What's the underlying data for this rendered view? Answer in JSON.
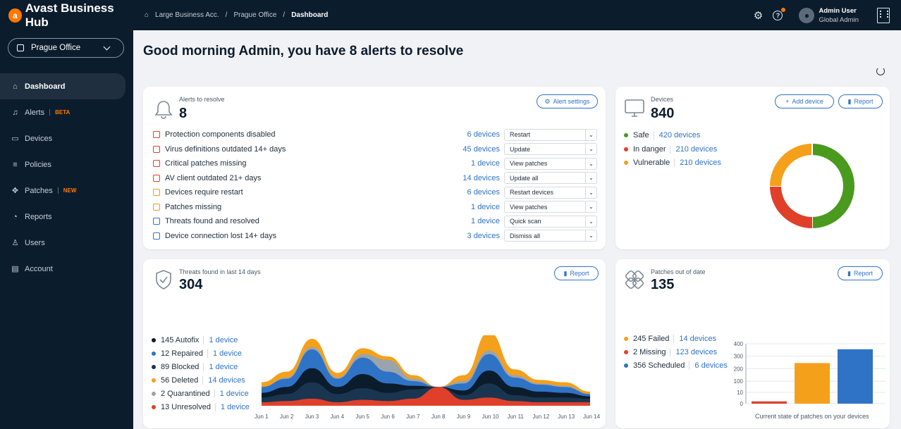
{
  "brand": {
    "name": "Avast Business Hub"
  },
  "breadcrumb": [
    "Large Business Acc.",
    "Prague Office",
    "Dashboard"
  ],
  "user": {
    "name": "Admin User",
    "role": "Global Admin"
  },
  "location": "Prague Office",
  "nav": [
    {
      "label": "Dashboard",
      "icon": "home-icon",
      "active": true
    },
    {
      "label": "Alerts",
      "icon": "bell-icon",
      "badge": "BETA"
    },
    {
      "label": "Devices",
      "icon": "monitor-icon"
    },
    {
      "label": "Policies",
      "icon": "policies-icon"
    },
    {
      "label": "Patches",
      "icon": "patches-icon",
      "badge": "NEW"
    },
    {
      "label": "Reports",
      "icon": "reports-icon"
    },
    {
      "label": "Users",
      "icon": "user-icon"
    },
    {
      "label": "Account",
      "icon": "account-icon"
    }
  ],
  "greeting": "Good morning Admin, you have 8 alerts to resolve",
  "alerts": {
    "title": "Alerts to resolve",
    "count": "8",
    "settings_label": "Alert settings",
    "rows": [
      {
        "label": "Protection components disabled",
        "count": "6 devices",
        "action": "Restart",
        "color": "#e0402a"
      },
      {
        "label": "Virus definitions outdated 14+ days",
        "count": "45 devices",
        "action": "Update",
        "color": "#e0402a"
      },
      {
        "label": "Critical patches missing",
        "count": "1 device",
        "action": "View patches",
        "color": "#e0402a"
      },
      {
        "label": "AV client outdated 21+ days",
        "count": "14 devices",
        "action": "Update all",
        "color": "#e0402a"
      },
      {
        "label": "Devices require restart",
        "count": "6 devices",
        "action": "Restart devices",
        "color": "#f29b14"
      },
      {
        "label": "Patches missing",
        "count": "1 device",
        "action": "View patches",
        "color": "#f29b14"
      },
      {
        "label": "Threats found and resolved",
        "count": "1 device",
        "action": "Quick scan",
        "color": "#2f73c6"
      },
      {
        "label": "Device connection lost 14+ days",
        "count": "3 devices",
        "action": "Dismiss all",
        "color": "#2f73c6"
      }
    ]
  },
  "devices": {
    "title": "Devices",
    "count": "840",
    "add_label": "Add device",
    "report_label": "Report",
    "legend": [
      {
        "label": "Safe",
        "count": "420 devices",
        "value": 420,
        "color": "#4a9a1e"
      },
      {
        "label": "In danger",
        "count": "210 devices",
        "value": 210,
        "color": "#e0402a"
      },
      {
        "label": "Vulnerable",
        "count": "210 devices",
        "value": 210,
        "color": "#f5a01a"
      }
    ]
  },
  "threats": {
    "title": "Threats found in last 14 days",
    "count": "304",
    "report_label": "Report",
    "legend": [
      {
        "label": "145  Autofix",
        "count": "1 device",
        "color": "#0b1c2c"
      },
      {
        "label": "12 Repaired",
        "count": "1 device",
        "color": "#2f73c6"
      },
      {
        "label": "89 Blocked",
        "count": "1 device",
        "color": "#1a3550"
      },
      {
        "label": "56 Deleted",
        "count": "14 devices",
        "color": "#f5a01a"
      },
      {
        "label": "2 Quarantined",
        "count": "1 device",
        "color": "#9aa4ad"
      },
      {
        "label": "13 Unresolved",
        "count": "1 device",
        "color": "#e0402a"
      }
    ],
    "x_labels": [
      "Jun 1",
      "Jun 2",
      "Jun 3",
      "Jun 4",
      "Jun 5",
      "Jun 6",
      "Jun 7",
      "Jun 8",
      "Jun 9",
      "Jun 10",
      "Jun 11",
      "Jun 12",
      "Jun 13",
      "Jun 14"
    ]
  },
  "patches": {
    "title": "Patches out of date",
    "count": "135",
    "report_label": "Report",
    "legend": [
      {
        "label": "245 Failed",
        "count": "14 devices",
        "color": "#f5a01a"
      },
      {
        "label": "2 Missing",
        "count": "123 devices",
        "color": "#e0402a"
      },
      {
        "label": "356 Scheduled",
        "count": "6 devices",
        "color": "#2f73c6"
      }
    ],
    "caption": "Current state of patches on your devices"
  },
  "chart_data": [
    {
      "type": "area",
      "title": "Threats found in last 14 days",
      "x": [
        "Jun 1",
        "Jun 2",
        "Jun 3",
        "Jun 4",
        "Jun 5",
        "Jun 6",
        "Jun 7",
        "Jun 8",
        "Jun 9",
        "Jun 10",
        "Jun 11",
        "Jun 12",
        "Jun 13",
        "Jun 14"
      ],
      "series": [
        {
          "name": "Unresolved",
          "values": [
            3,
            4,
            6,
            3,
            5,
            4,
            6,
            16,
            5,
            7,
            4,
            3,
            3,
            3
          ]
        },
        {
          "name": "Blocked",
          "values": [
            4,
            6,
            14,
            7,
            10,
            7,
            8,
            0,
            4,
            12,
            5,
            4,
            4,
            3
          ]
        },
        {
          "name": "Autofix",
          "values": [
            4,
            6,
            12,
            6,
            12,
            8,
            3,
            0,
            4,
            11,
            7,
            5,
            4,
            2
          ]
        },
        {
          "name": "Repaired",
          "values": [
            5,
            7,
            16,
            7,
            14,
            10,
            4,
            0,
            6,
            14,
            8,
            6,
            5,
            2
          ]
        },
        {
          "name": "Quarantined",
          "values": [
            0,
            1,
            2,
            1,
            3,
            10,
            2,
            0,
            2,
            3,
            2,
            1,
            1,
            0
          ]
        },
        {
          "name": "Deleted",
          "values": [
            4,
            5,
            7,
            4,
            5,
            3,
            3,
            0,
            5,
            16,
            5,
            3,
            3,
            2
          ]
        }
      ],
      "colors": [
        "#e0402a",
        "#1a3550",
        "#0b1c2c",
        "#2f73c6",
        "#9aa4ad",
        "#f5a01a"
      ]
    },
    {
      "type": "bar",
      "title": "",
      "categories": [
        "Missing",
        "Failed",
        "Scheduled"
      ],
      "values": [
        2,
        245,
        356
      ],
      "colors": [
        "#e0402a",
        "#f5a01a",
        "#2f73c6"
      ],
      "ylim": [
        0,
        400
      ],
      "yticks": [
        0,
        10,
        100,
        200,
        300,
        400
      ],
      "xlabel": "Current state of patches on your devices"
    },
    {
      "type": "pie",
      "title": "Devices",
      "categories": [
        "Safe",
        "In danger",
        "Vulnerable"
      ],
      "values": [
        420,
        210,
        210
      ],
      "colors": [
        "#4a9a1e",
        "#e0402a",
        "#f5a01a"
      ]
    }
  ]
}
